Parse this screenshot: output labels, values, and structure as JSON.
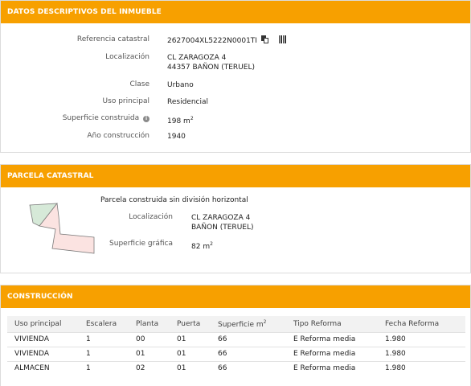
{
  "datos": {
    "header": "DATOS DESCRIPTIVOS DEL INMUEBLE",
    "referencia_label": "Referencia catastral",
    "referencia_value": "2627004XL5222N0001TI",
    "localizacion_label": "Localización",
    "localizacion_line1": "CL ZARAGOZA 4",
    "localizacion_line2": "44357 BAÑON (TERUEL)",
    "clase_label": "Clase",
    "clase_value": "Urbano",
    "uso_label": "Uso principal",
    "uso_value": "Residencial",
    "superficie_label": "Superficie construida",
    "superficie_value": "198 m",
    "superficie_exp": "2",
    "anio_label": "Año construcción",
    "anio_value": "1940",
    "info_icon_glyph": "i"
  },
  "parcela": {
    "header": "PARCELA CATASTRAL",
    "title": "Parcela construida sin división horizontal",
    "localizacion_label": "Localización",
    "localizacion_line1": "CL ZARAGOZA 4",
    "localizacion_line2": "BAÑON (TERUEL)",
    "superficie_label": "Superficie gráfica",
    "superficie_value": "82 m",
    "superficie_exp": "2",
    "map_colors": {
      "green": "#d6e9d8",
      "pink": "#fbe3e1",
      "outline": "#7a7a7a"
    }
  },
  "construccion": {
    "header": "CONSTRUCCIÓN",
    "columns": [
      "Uso principal",
      "Escalera",
      "Planta",
      "Puerta",
      "Superficie m",
      "Tipo Reforma",
      "Fecha Reforma"
    ],
    "superficie_exp": "2",
    "rows": [
      [
        "VIVIENDA",
        "1",
        "00",
        "01",
        "66",
        "E Reforma media",
        "1.980"
      ],
      [
        "VIVIENDA",
        "1",
        "01",
        "01",
        "66",
        "E Reforma media",
        "1.980"
      ],
      [
        "ALMACEN",
        "1",
        "02",
        "01",
        "66",
        "E Reforma media",
        "1.980"
      ]
    ]
  },
  "colors": {
    "accent": "#f7a000"
  }
}
